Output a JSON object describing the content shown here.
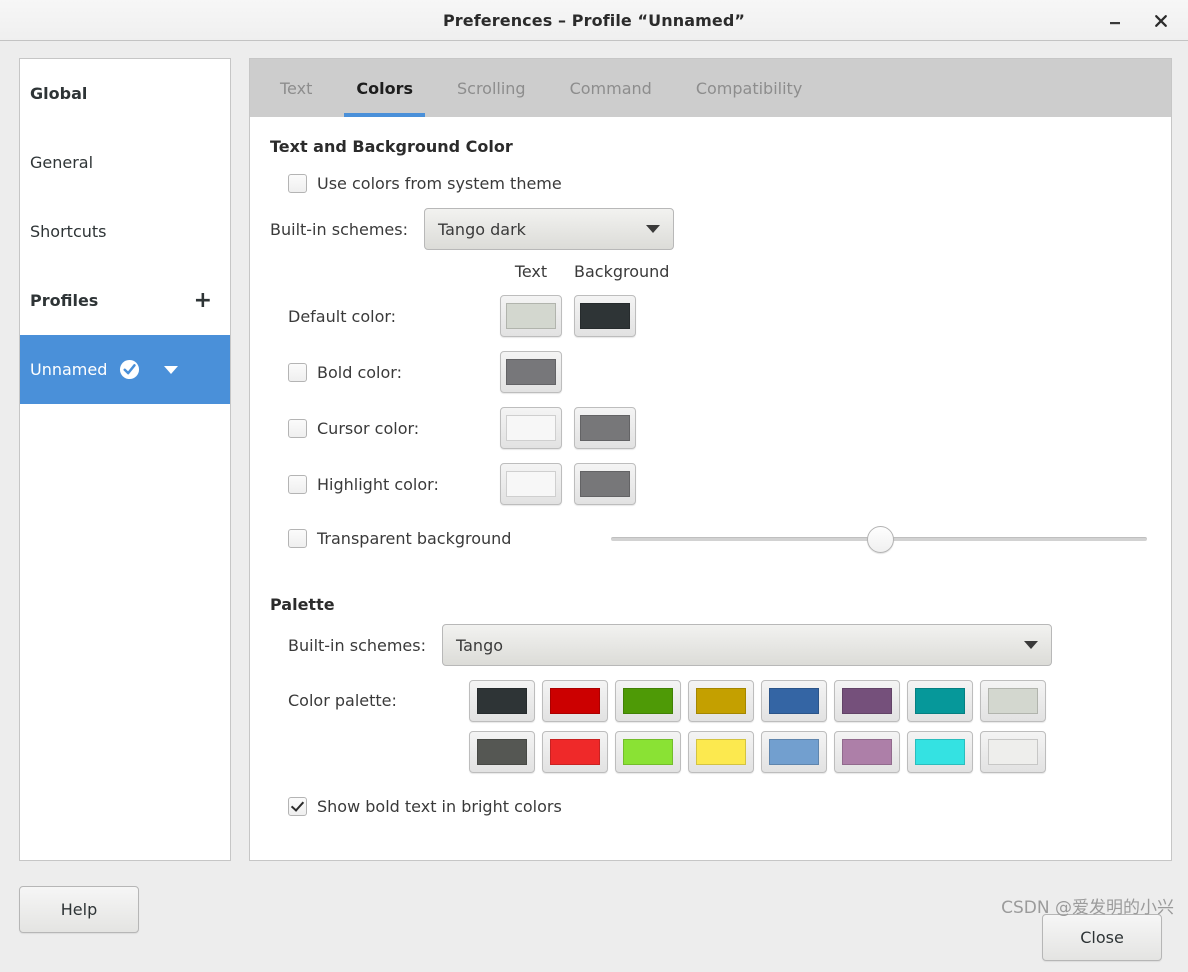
{
  "window": {
    "title": "Preferences – Profile “Unnamed”",
    "minimize_icon": "minimize-icon",
    "close_icon": "close-icon"
  },
  "sidebar": {
    "groups": [
      {
        "label": "Global",
        "type": "header"
      },
      {
        "label": "General",
        "type": "item"
      },
      {
        "label": "Shortcuts",
        "type": "item"
      },
      {
        "label": "Profiles",
        "type": "header",
        "action_label": "+"
      },
      {
        "label": "Unnamed",
        "type": "profile",
        "selected": true,
        "badge_icon": "check-circle-icon",
        "menu_icon": "chevron-down-icon"
      }
    ]
  },
  "tabs": [
    {
      "label": "Text",
      "active": false
    },
    {
      "label": "Colors",
      "active": true
    },
    {
      "label": "Scrolling",
      "active": false
    },
    {
      "label": "Command",
      "active": false
    },
    {
      "label": "Compatibility",
      "active": false
    }
  ],
  "colors_page": {
    "text_bg_section": {
      "title": "Text and Background Color",
      "use_system_theme": {
        "label": "Use colors from system theme",
        "checked": false
      },
      "builtin_schemes": {
        "label": "Built-in schemes:",
        "value": "Tango dark"
      },
      "column_headers": {
        "text": "Text",
        "background": "Background"
      },
      "rows": [
        {
          "label": "Default color:",
          "has_checkbox": false,
          "checked": false,
          "text_color": "#d3d7cf",
          "background_color": "#2e3436",
          "has_background": true
        },
        {
          "label": "Bold color:",
          "has_checkbox": true,
          "checked": false,
          "text_color": "#77777a",
          "background_color": null,
          "has_background": false
        },
        {
          "label": "Cursor color:",
          "has_checkbox": true,
          "checked": false,
          "text_color": "#f7f7f7",
          "background_color": "#777779",
          "has_background": true
        },
        {
          "label": "Highlight color:",
          "has_checkbox": true,
          "checked": false,
          "text_color": "#f7f7f7",
          "background_color": "#777779",
          "has_background": true
        }
      ],
      "transparent_background": {
        "label": "Transparent background",
        "checked": false,
        "slider_percent": 50
      }
    },
    "palette_section": {
      "title": "Palette",
      "builtin_schemes": {
        "label": "Built-in schemes:",
        "value": "Tango"
      },
      "palette_label": "Color palette:",
      "palette_rows": [
        [
          "#2e3436",
          "#cc0000",
          "#4e9a06",
          "#c4a000",
          "#3465a4",
          "#75507b",
          "#06989a",
          "#d3d7cf"
        ],
        [
          "#555753",
          "#ef2929",
          "#8ae234",
          "#fce94f",
          "#729fcf",
          "#ad7fa8",
          "#34e2e2",
          "#eeeeec"
        ]
      ],
      "show_bold_bright": {
        "label": "Show bold text in bright colors",
        "checked": true
      }
    }
  },
  "actions": {
    "help_label": "Help",
    "close_label": "Close"
  },
  "watermark": "CSDN @爱发明的小兴"
}
